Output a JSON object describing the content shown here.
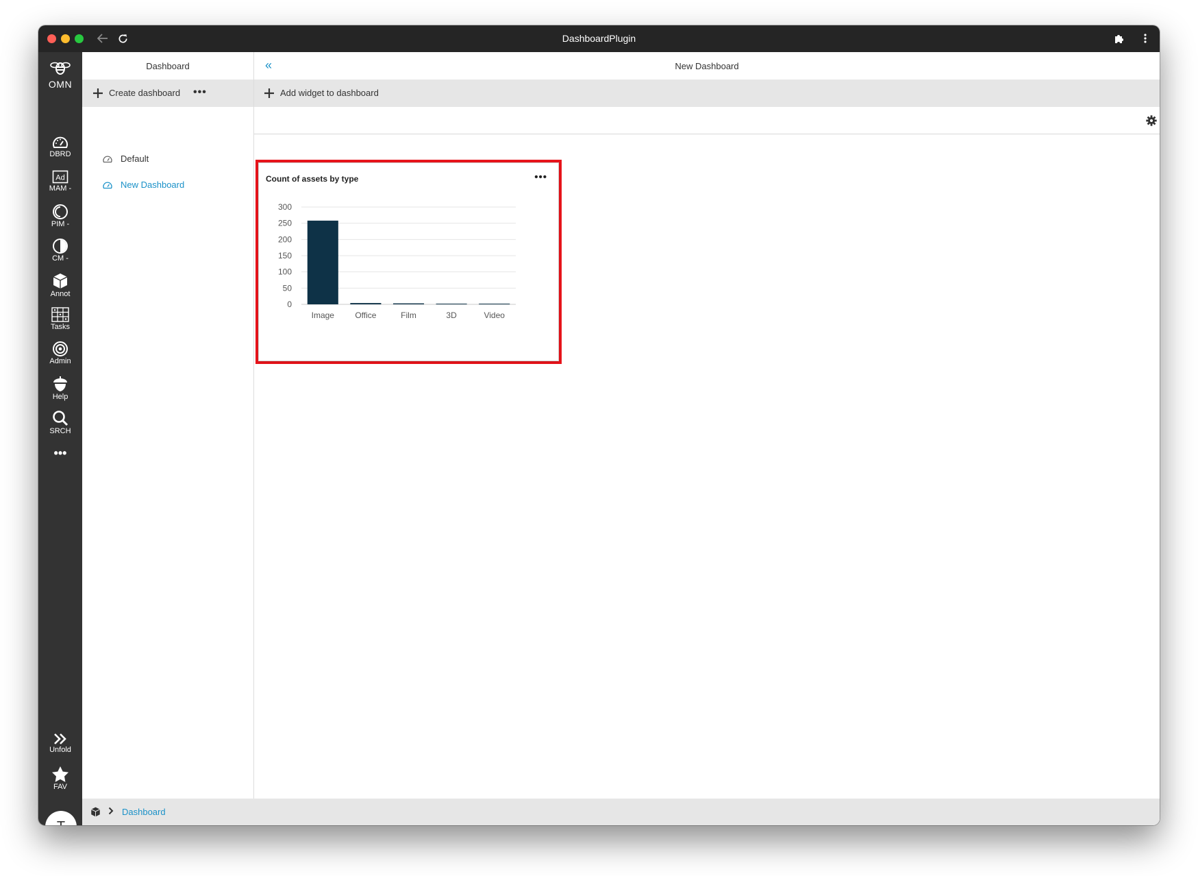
{
  "window": {
    "title": "DashboardPlugin"
  },
  "rail": {
    "logo": "OMN",
    "items": [
      {
        "label": "DBRD",
        "icon": "gauge-icon"
      },
      {
        "label": "MAM -",
        "icon": "ad-icon"
      },
      {
        "label": "PIM -",
        "icon": "pim-circle-icon"
      },
      {
        "label": "CM -",
        "icon": "half-circle-icon"
      },
      {
        "label": "Annot",
        "icon": "cube-icon"
      },
      {
        "label": "Tasks",
        "icon": "tasks-grid-icon"
      },
      {
        "label": "Admin",
        "icon": "target-icon"
      },
      {
        "label": "Help",
        "icon": "acorn-icon"
      },
      {
        "label": "SRCH",
        "icon": "search-icon"
      }
    ],
    "more": "•••",
    "bottom_items": [
      {
        "label": "Unfold",
        "icon": "double-chevron-right-icon"
      },
      {
        "label": "FAV",
        "icon": "star-icon"
      }
    ],
    "avatar_initial": "T"
  },
  "panel": {
    "title": "Dashboard",
    "create_label": "Create dashboard",
    "more": "•••",
    "dashboards": [
      {
        "label": "Default",
        "selected": false
      },
      {
        "label": "New Dashboard",
        "selected": true
      }
    ]
  },
  "main": {
    "collapse": "«",
    "title": "New Dashboard",
    "add_widget_label": "Add widget to dashboard",
    "widget": {
      "title": "Count of assets by type",
      "more": "•••"
    }
  },
  "footer": {
    "breadcrumb": "Dashboard"
  },
  "colors": {
    "accent": "#1a91c8",
    "bar": "#0e3247",
    "highlight": "#e8141b",
    "rail": "#333333"
  },
  "chart_data": {
    "type": "bar",
    "categories": [
      "Image",
      "Office",
      "Film",
      "3D",
      "Video"
    ],
    "values": [
      258,
      4,
      3,
      1,
      1
    ],
    "yticks": [
      0,
      50,
      100,
      150,
      200,
      250,
      300
    ],
    "ylim": [
      0,
      300
    ],
    "grid": true
  }
}
